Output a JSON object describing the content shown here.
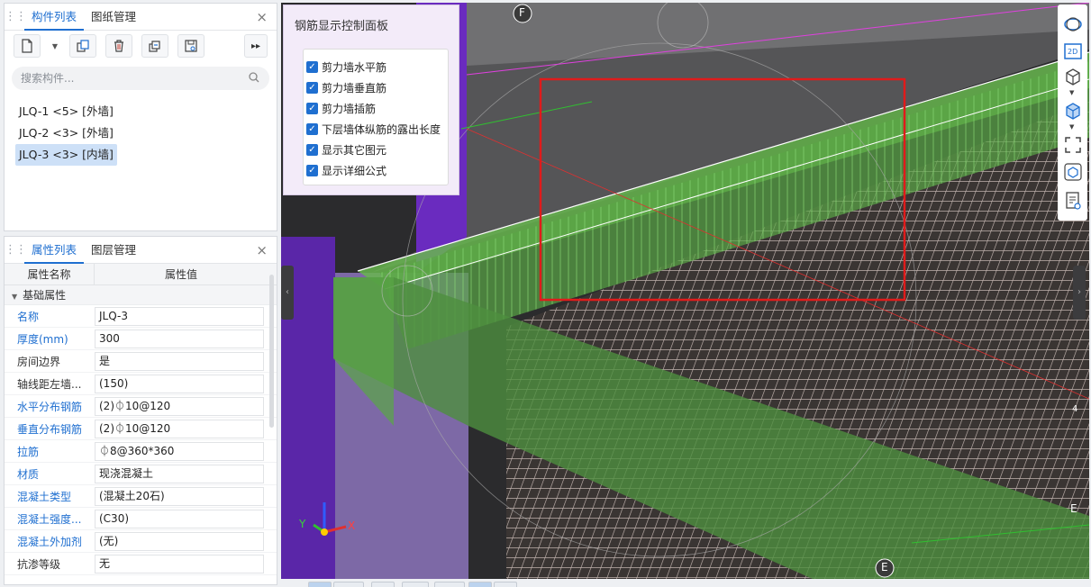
{
  "component_panel": {
    "tabs": [
      {
        "label": "构件列表"
      },
      {
        "label": "图纸管理"
      }
    ],
    "close": "×",
    "search_placeholder": "搜索构件...",
    "items": [
      {
        "label": "JLQ-1 <5> [外墙]"
      },
      {
        "label": "JLQ-2 <3> [外墙]"
      },
      {
        "label": "JLQ-3 <3> [内墙]"
      }
    ]
  },
  "property_panel": {
    "tabs": [
      {
        "label": "属性列表"
      },
      {
        "label": "图层管理"
      }
    ],
    "close": "×",
    "col_name": "属性名称",
    "col_value": "属性值",
    "group": "基础属性",
    "rows": [
      {
        "name": "名称",
        "value": "JLQ-3"
      },
      {
        "name": "厚度(mm)",
        "value": "300"
      },
      {
        "name": "房间边界",
        "value": "是"
      },
      {
        "name": "轴线距左墙...",
        "value": "(150)"
      },
      {
        "name": "水平分布钢筋",
        "value": "(2)⏀10@120"
      },
      {
        "name": "垂直分布钢筋",
        "value": "(2)⏀10@120"
      },
      {
        "name": "拉筋",
        "value": "⏀8@360*360"
      },
      {
        "name": "材质",
        "value": "现浇混凝土"
      },
      {
        "name": "混凝土类型",
        "value": "(混凝土20石)"
      },
      {
        "name": "混凝土强度...",
        "value": "(C30)"
      },
      {
        "name": "混凝土外加剂",
        "value": "(无)"
      },
      {
        "name": "抗渗等级",
        "value": "无"
      }
    ]
  },
  "rebar_panel": {
    "title": "钢筋显示控制面板",
    "options": [
      {
        "label": "剪力墙水平筋",
        "checked": true
      },
      {
        "label": "剪力墙垂直筋",
        "checked": true
      },
      {
        "label": "剪力墙插筋",
        "checked": true
      },
      {
        "label": "下层墙体纵筋的露出长度",
        "checked": true
      },
      {
        "label": "显示其它图元",
        "checked": true
      },
      {
        "label": "显示详细公式",
        "checked": true
      }
    ]
  },
  "viewport": {
    "axis_top": "F",
    "axis_bottom": "E",
    "axis_right": "E",
    "axis_right_num": "4",
    "gizmo": {
      "x": "X",
      "y": "Y"
    },
    "right_tool_2d": "2D"
  },
  "colors": {
    "accent": "#1f6fd0",
    "wall_green": "#5fbf4a",
    "selection_red": "#e01b1b",
    "purple": "#6a2bbf"
  }
}
